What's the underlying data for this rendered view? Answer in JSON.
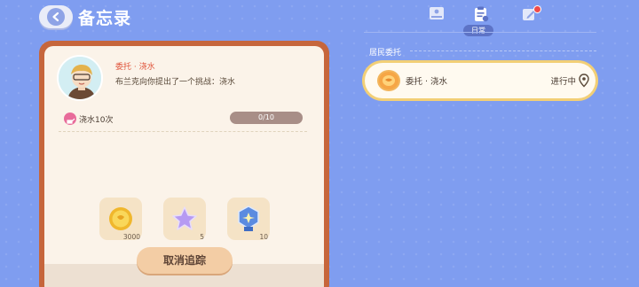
{
  "header": {
    "title": "备忘录"
  },
  "tabs": {
    "active_label": "日常"
  },
  "quest": {
    "name": "委托 · 浇水",
    "description": "布兰克向你提出了一个挑战：浇水",
    "objective": {
      "text": "浇水10次",
      "progress_text": "0/10",
      "progress_fraction": 0.0
    },
    "rewards": [
      {
        "icon": "gold-coin-icon",
        "count": "3000"
      },
      {
        "icon": "purple-star-icon",
        "count": "5"
      },
      {
        "icon": "blue-badge-icon",
        "count": "10"
      }
    ],
    "cancel_label": "取消追踪"
  },
  "resident_tasks": {
    "section_title": "居民委托",
    "items": [
      {
        "name": "委托 · 浇水",
        "status": "进行中",
        "icon": "coin-plate-icon"
      }
    ]
  },
  "colors": {
    "background": "#7f9df0",
    "card_frame": "#c6663c",
    "accent_red": "#e0553c",
    "task_border": "#f2cf76"
  }
}
